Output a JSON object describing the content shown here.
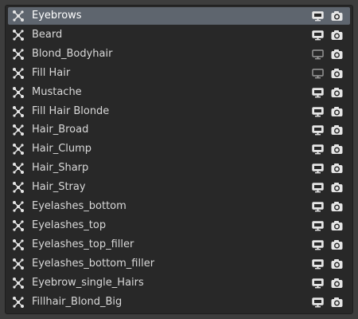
{
  "items": [
    {
      "label": "Eyebrows",
      "type_icon": "curve-icon",
      "viewport_enabled": true,
      "render_enabled": true,
      "active": true
    },
    {
      "label": "Beard",
      "type_icon": "curve-icon",
      "viewport_enabled": true,
      "render_enabled": true,
      "active": false
    },
    {
      "label": "Blond_Bodyhair",
      "type_icon": "curve-icon",
      "viewport_enabled": false,
      "render_enabled": true,
      "active": false
    },
    {
      "label": "Fill Hair",
      "type_icon": "curve-icon",
      "viewport_enabled": false,
      "render_enabled": true,
      "active": false
    },
    {
      "label": "Mustache",
      "type_icon": "curve-icon",
      "viewport_enabled": true,
      "render_enabled": true,
      "active": false
    },
    {
      "label": "Fill Hair Blonde",
      "type_icon": "curve-icon",
      "viewport_enabled": true,
      "render_enabled": true,
      "active": false
    },
    {
      "label": "Hair_Broad",
      "type_icon": "curve-icon",
      "viewport_enabled": true,
      "render_enabled": true,
      "active": false
    },
    {
      "label": "Hair_Clump",
      "type_icon": "curve-icon",
      "viewport_enabled": true,
      "render_enabled": true,
      "active": false
    },
    {
      "label": "Hair_Sharp",
      "type_icon": "curve-icon",
      "viewport_enabled": true,
      "render_enabled": true,
      "active": false
    },
    {
      "label": "Hair_Stray",
      "type_icon": "curve-icon",
      "viewport_enabled": true,
      "render_enabled": true,
      "active": false
    },
    {
      "label": "Eyelashes_bottom",
      "type_icon": "curve-icon",
      "viewport_enabled": true,
      "render_enabled": true,
      "active": false
    },
    {
      "label": "Eyelashes_top",
      "type_icon": "curve-icon",
      "viewport_enabled": true,
      "render_enabled": true,
      "active": false
    },
    {
      "label": "Eyelashes_top_filler",
      "type_icon": "curve-icon",
      "viewport_enabled": true,
      "render_enabled": true,
      "active": false
    },
    {
      "label": "Eyelashes_bottom_filler",
      "type_icon": "curve-icon",
      "viewport_enabled": true,
      "render_enabled": true,
      "active": false
    },
    {
      "label": "Eyebrow_single_Hairs",
      "type_icon": "curve-icon",
      "viewport_enabled": true,
      "render_enabled": true,
      "active": false
    },
    {
      "label": "Fillhair_Blond_Big",
      "type_icon": "curve-icon",
      "viewport_enabled": true,
      "render_enabled": true,
      "active": false
    }
  ],
  "colors": {
    "panel_background": "#3d3d3d",
    "list_background": "#282828",
    "active_row": "#5e656e",
    "text": "#d9d9d9",
    "icon_enabled": "#e6e6e6",
    "icon_disabled": "#9a9a9a"
  }
}
